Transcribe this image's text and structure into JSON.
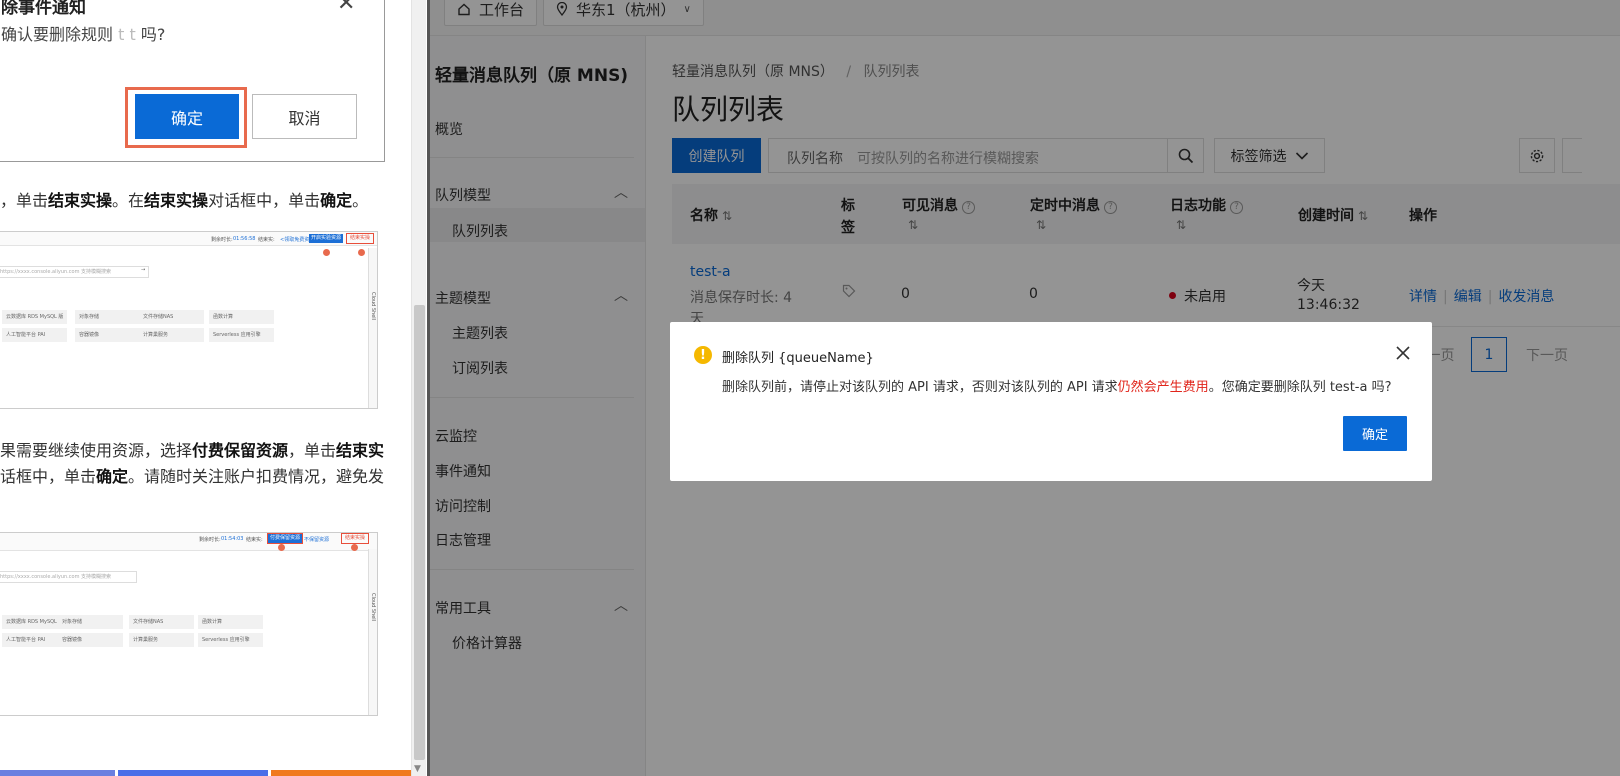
{
  "left_doc": {
    "dialog_title": "除事件通知",
    "dialog_question_prefix": "确认要删除规则",
    "dialog_question_masked": "t   t",
    "dialog_question_suffix": "吗?",
    "dialog_ok": "确定",
    "dialog_cancel": "取消",
    "para1": {
      "a": "，单击",
      "b": "结束实操",
      "c": "。在",
      "d": "结束实操",
      "e": "对话框中，单击",
      "f": "确定",
      "g": "。"
    },
    "para2_line1": {
      "a": "果需要继续使用资源，选择",
      "b": "付费保留资源",
      "c": "，单击",
      "d": "结束实"
    },
    "para2_line2": {
      "a": "话框中，单击",
      "b": "确定",
      "c": "。请随时关注账户扣费情况，避免发"
    },
    "shot1": {
      "timer_label": "剩余时长:",
      "timer_value": "01:56:58",
      "status_label": "结束实:",
      "btn_return": "<领取免费资源",
      "btn_open": "开启实验资源",
      "btn_end": "结束实操",
      "search_placeholder": "https://xxxx.console.aliyun.com 支持模糊搜索",
      "cells": [
        "云数据库 RDS MySQL 版",
        "对象存储",
        "文件存储NAS",
        "函数计算",
        "人工智能平台 PAI",
        "容器镜像",
        "计算巢服务",
        "Serverless 应用引擎"
      ],
      "side_text": "Cloud Shell"
    },
    "shot2": {
      "timer_label": "剩余时长:",
      "timer_value": "01:54:03",
      "status_label": "结束实:",
      "btn_pay": "付费保留资源",
      "btn_free": "不保留资源",
      "btn_end": "结束实操",
      "search_placeholder": "https://xxxx.console.aliyun.com 支持模糊搜索",
      "cells": [
        "云数据库 RDS MySQL 版",
        "对象存储",
        "文件存储NAS",
        "函数计算",
        "人工智能平台 PAI",
        "容器镜像",
        "计算巢服务",
        "Serverless 应用引擎"
      ],
      "side_text": "Cloud Shell"
    }
  },
  "topbar": {
    "workbench": "工作台",
    "region": "华东1（杭州）"
  },
  "sidenav": {
    "title": "轻量消息队列（原 MNS)",
    "overview": "概览",
    "queue_model": "队列模型",
    "queue_list": "队列列表",
    "topic_model": "主题模型",
    "topic_list": "主题列表",
    "sub_list": "订阅列表",
    "cloud_monitor": "云监控",
    "event_notify": "事件通知",
    "access_control": "访问控制",
    "log_manage": "日志管理",
    "tools": "常用工具",
    "price_calc": "价格计算器"
  },
  "main": {
    "breadcrumb_root": "轻量消息队列（原 MNS）",
    "breadcrumb_sep": "/",
    "breadcrumb_current": "队列列表",
    "page_title": "队列列表",
    "create_button": "创建队列",
    "search_label": "队列名称",
    "search_placeholder": "可按队列的名称进行模糊搜索",
    "tag_filter": "标签筛选",
    "columns": {
      "name": "名称",
      "tag_line1": "标",
      "tag_line2": "签",
      "visible": "可见消息",
      "delayed": "定时中消息",
      "logging": "日志功能",
      "created": "创建时间",
      "actions": "操作"
    },
    "sort_glyph": "⇅",
    "row": {
      "name": "test-a",
      "retention_line1": "消息保存时长: 4",
      "retention_line2": "天",
      "visible": "0",
      "delayed": "0",
      "logging_status": "未启用",
      "created_line1": "今天",
      "created_line2": "13:46:32",
      "action_detail": "详情",
      "action_edit": "编辑",
      "action_send": "收发消息"
    },
    "pagination": {
      "prev": "上一页",
      "page": "1",
      "next": "下一页"
    }
  },
  "modal": {
    "title": "删除队列 {queueName}",
    "text_before": "删除队列前，请停止对该队列的 API 请求，否则对该队列的 API 请求",
    "text_red": "仍然会产生费用",
    "text_after": "。您确定要删除队列 test-a 吗?",
    "ok": "确定"
  },
  "colors": {
    "primary": "#0a6ad6",
    "danger_text": "#e1251b",
    "warning": "#f5b800",
    "highlight_box": "#e86a4d",
    "status_dot": "#d9001b"
  }
}
